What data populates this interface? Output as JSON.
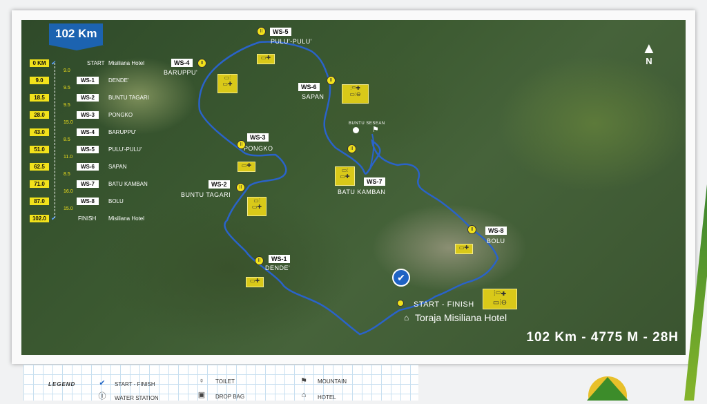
{
  "distance_badge": "102 Km",
  "summary": "102 Km - 4775 M - 28H",
  "north_label": "N",
  "checkpoints": [
    {
      "km": "0 KM",
      "code": "",
      "name": "START",
      "place": "Misiliana Hotel"
    },
    {
      "km": "9.0",
      "code": "WS-1",
      "name": "DENDE'",
      "place": ""
    },
    {
      "km": "18.5",
      "code": "WS-2",
      "name": "BUNTU TAGARI",
      "place": ""
    },
    {
      "km": "28.0",
      "code": "WS-3",
      "name": "PONGKO",
      "place": ""
    },
    {
      "km": "43.0",
      "code": "WS-4",
      "name": "BARUPPU'",
      "place": ""
    },
    {
      "km": "51.0",
      "code": "WS-5",
      "name": "PULU'-PULU'",
      "place": ""
    },
    {
      "km": "62.5",
      "code": "WS-6",
      "name": "SAPAN",
      "place": ""
    },
    {
      "km": "71.0",
      "code": "WS-7",
      "name": "BATU KAMBAN",
      "place": ""
    },
    {
      "km": "87.0",
      "code": "WS-8",
      "name": "BOLU",
      "place": ""
    },
    {
      "km": "102.0",
      "code": "",
      "name": "FINISH",
      "place": "Misiliana Hotel"
    }
  ],
  "segments": [
    "9.0",
    "9.5",
    "9.5",
    "15.0",
    "8.5",
    "11.0",
    "8.5",
    "16.0",
    "15.0"
  ],
  "map_labels": {
    "ws1": {
      "code": "WS-1",
      "name": "DENDE'"
    },
    "ws2": {
      "code": "WS-2",
      "name": "BUNTU TAGARI"
    },
    "ws3": {
      "code": "WS-3",
      "name": "PONGKO"
    },
    "ws4": {
      "code": "WS-4",
      "name": "BARUPPU'"
    },
    "ws5": {
      "code": "WS-5",
      "name": "PULU'-PULU'"
    },
    "ws6": {
      "code": "WS-6",
      "name": "SAPAN"
    },
    "ws7": {
      "code": "WS-7",
      "name": "BATU KAMBAN"
    },
    "ws8": {
      "code": "WS-8",
      "name": "BOLU"
    },
    "mountain": "BUNTU SESEAN",
    "start_finish": "START - FINISH",
    "hotel": "Toraja Misiliana Hotel"
  },
  "legend": {
    "title": "LEGEND",
    "items": [
      "START - FINISH",
      "WATER STATION",
      "TOILET",
      "DROP BAG",
      "MOUNTAIN",
      "HOTEL"
    ]
  },
  "colors": {
    "route": "#2a63c9",
    "badge": "#1c63b0",
    "accent": "#f2e21b"
  }
}
